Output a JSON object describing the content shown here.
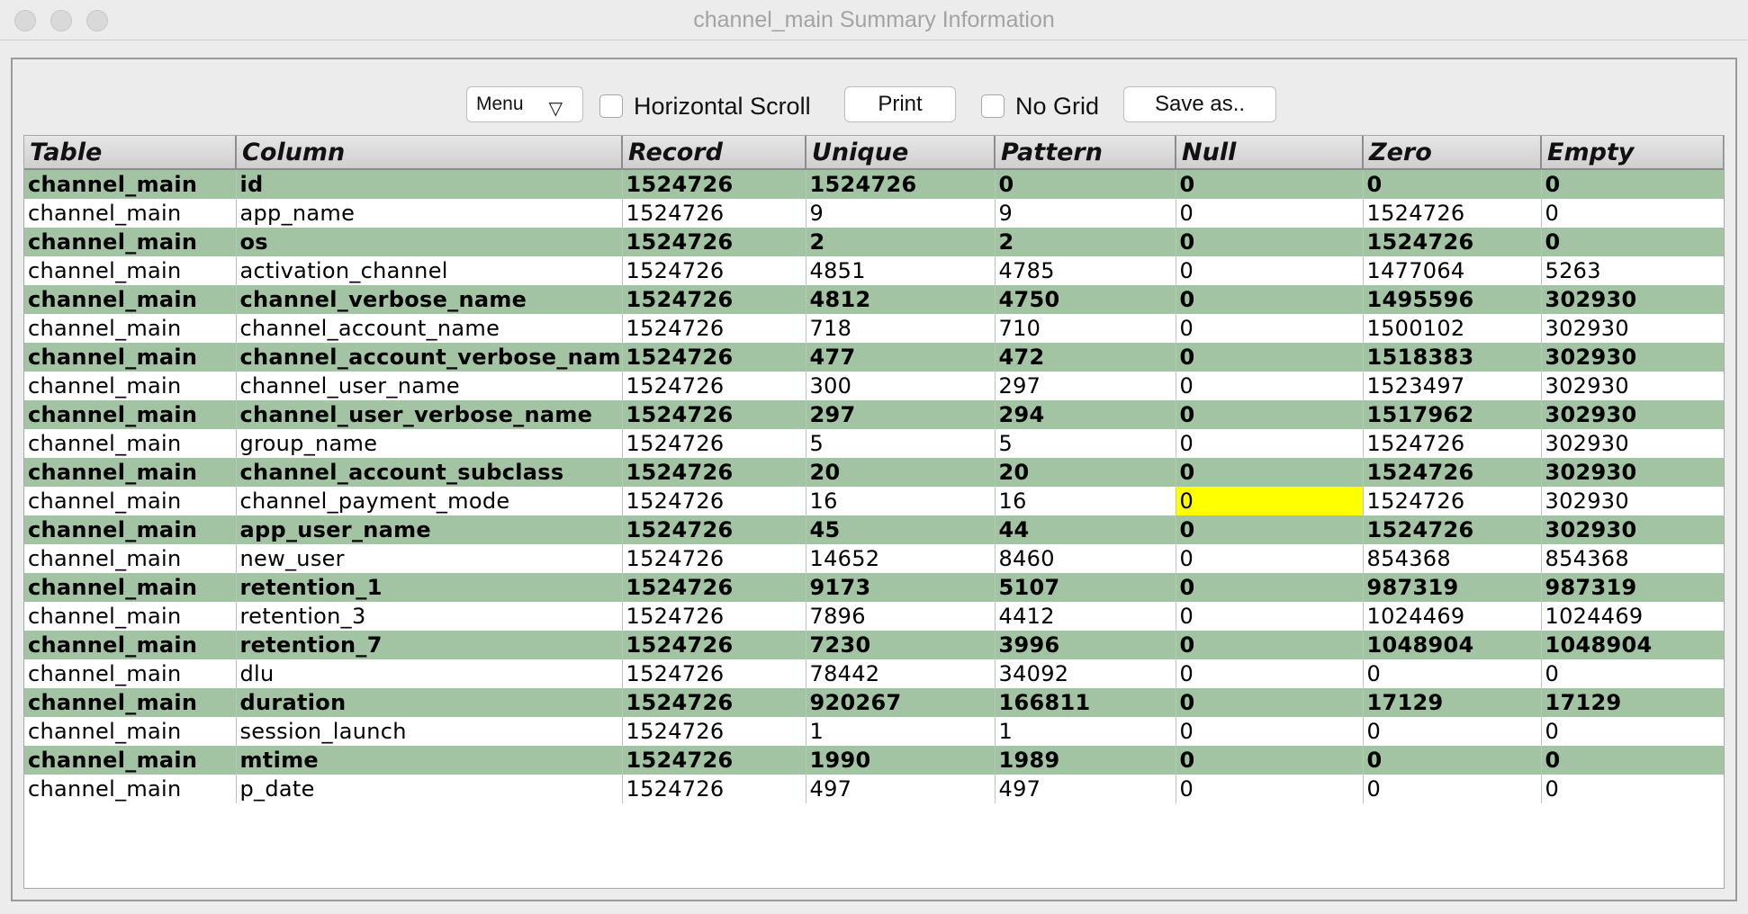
{
  "window": {
    "title": "channel_main Summary Information"
  },
  "toolbar": {
    "menu_label": "Menu",
    "menu_arrow": "▽",
    "horizontal_scroll_label": "Horizontal Scroll",
    "horizontal_scroll_checked": false,
    "print_label": "Print",
    "no_grid_label": "No Grid",
    "no_grid_checked": false,
    "save_as_label": "Save as.."
  },
  "table": {
    "columns": [
      "Table",
      "Column",
      "Record",
      "Unique",
      "Pattern",
      "Null",
      "Zero",
      "Empty"
    ],
    "highlighted_cell": {
      "row": 11,
      "col": 5,
      "color": "#ffff00"
    },
    "row_colors": {
      "even": "#a3c4a3",
      "odd": "#ffffff"
    },
    "rows": [
      [
        "channel_main",
        "id",
        "1524726",
        "1524726",
        "0",
        "0",
        "0",
        "0"
      ],
      [
        "channel_main",
        "app_name",
        "1524726",
        "9",
        "9",
        "0",
        "1524726",
        "0"
      ],
      [
        "channel_main",
        "os",
        "1524726",
        "2",
        "2",
        "0",
        "1524726",
        "0"
      ],
      [
        "channel_main",
        "activation_channel",
        "1524726",
        "4851",
        "4785",
        "0",
        "1477064",
        "5263"
      ],
      [
        "channel_main",
        "channel_verbose_name",
        "1524726",
        "4812",
        "4750",
        "0",
        "1495596",
        "302930"
      ],
      [
        "channel_main",
        "channel_account_name",
        "1524726",
        "718",
        "710",
        "0",
        "1500102",
        "302930"
      ],
      [
        "channel_main",
        "channel_account_verbose_name",
        "1524726",
        "477",
        "472",
        "0",
        "1518383",
        "302930"
      ],
      [
        "channel_main",
        "channel_user_name",
        "1524726",
        "300",
        "297",
        "0",
        "1523497",
        "302930"
      ],
      [
        "channel_main",
        "channel_user_verbose_name",
        "1524726",
        "297",
        "294",
        "0",
        "1517962",
        "302930"
      ],
      [
        "channel_main",
        "group_name",
        "1524726",
        "5",
        "5",
        "0",
        "1524726",
        "302930"
      ],
      [
        "channel_main",
        "channel_account_subclass",
        "1524726",
        "20",
        "20",
        "0",
        "1524726",
        "302930"
      ],
      [
        "channel_main",
        "channel_payment_mode",
        "1524726",
        "16",
        "16",
        "0",
        "1524726",
        "302930"
      ],
      [
        "channel_main",
        "app_user_name",
        "1524726",
        "45",
        "44",
        "0",
        "1524726",
        "302930"
      ],
      [
        "channel_main",
        "new_user",
        "1524726",
        "14652",
        "8460",
        "0",
        "854368",
        "854368"
      ],
      [
        "channel_main",
        "retention_1",
        "1524726",
        "9173",
        "5107",
        "0",
        "987319",
        "987319"
      ],
      [
        "channel_main",
        "retention_3",
        "1524726",
        "7896",
        "4412",
        "0",
        "1024469",
        "1024469"
      ],
      [
        "channel_main",
        "retention_7",
        "1524726",
        "7230",
        "3996",
        "0",
        "1048904",
        "1048904"
      ],
      [
        "channel_main",
        "dlu",
        "1524726",
        "78442",
        "34092",
        "0",
        "0",
        "0"
      ],
      [
        "channel_main",
        "duration",
        "1524726",
        "920267",
        "166811",
        "0",
        "17129",
        "17129"
      ],
      [
        "channel_main",
        "session_launch",
        "1524726",
        "1",
        "1",
        "0",
        "0",
        "0"
      ],
      [
        "channel_main",
        "mtime",
        "1524726",
        "1990",
        "1989",
        "0",
        "0",
        "0"
      ],
      [
        "channel_main",
        "p_date",
        "1524726",
        "497",
        "497",
        "0",
        "0",
        "0"
      ]
    ]
  }
}
